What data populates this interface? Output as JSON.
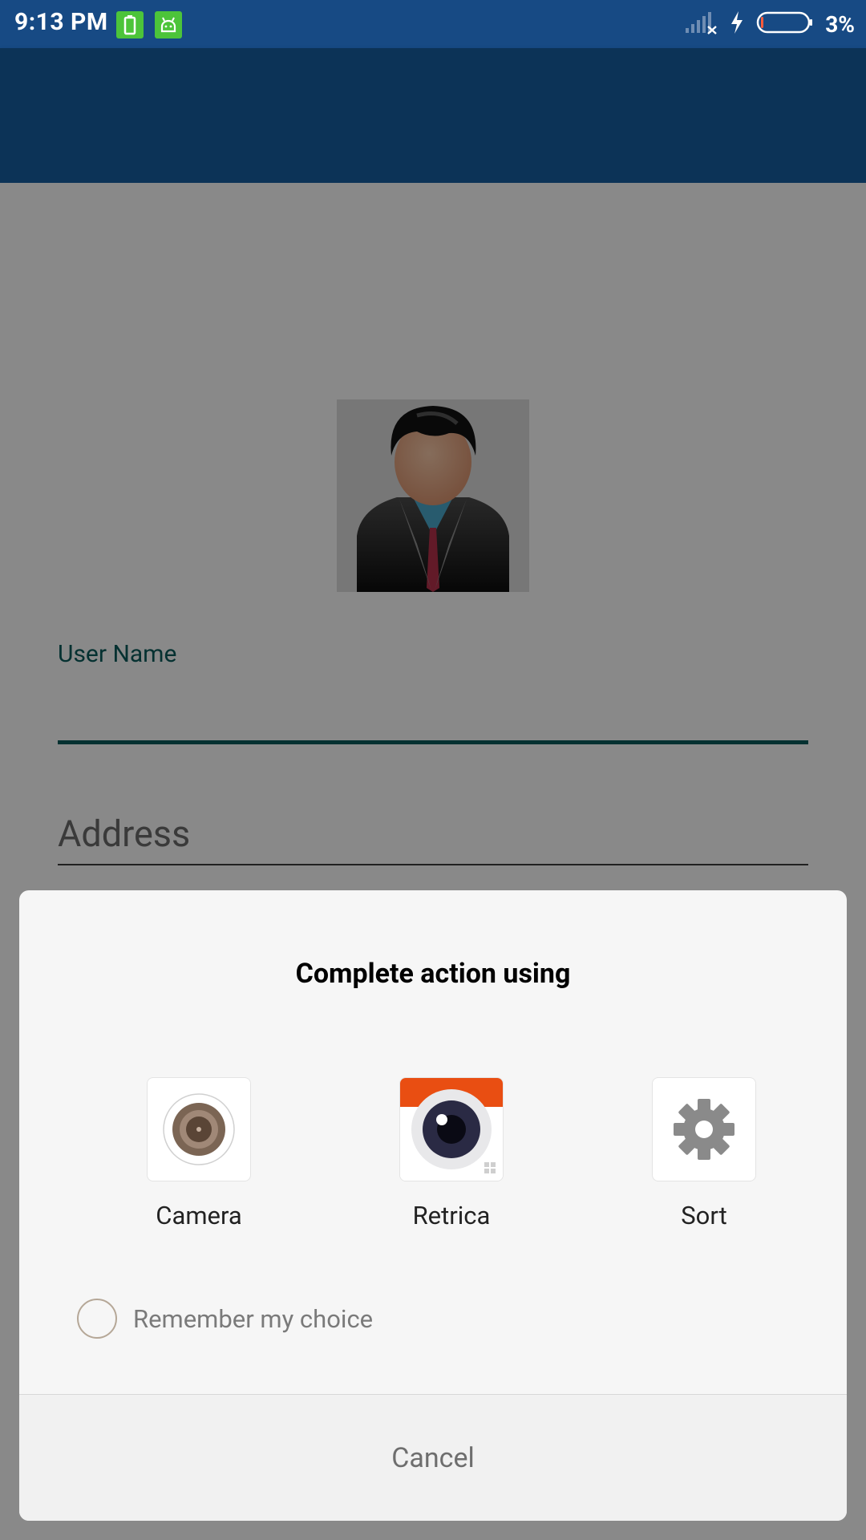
{
  "status_bar": {
    "time": "9:13 PM",
    "battery_percent": "3%",
    "icons": [
      "battery-saver-icon",
      "android-debug-icon",
      "signal-off-icon",
      "charging-bolt-icon",
      "battery-icon"
    ]
  },
  "form": {
    "username_label": "User Name",
    "address_placeholder": "Address",
    "avatar_icon": "person-avatar-icon"
  },
  "dialog": {
    "title": "Complete action using",
    "apps": [
      {
        "label": "Camera",
        "icon": "camera-lens-icon"
      },
      {
        "label": "Retrica",
        "icon": "retrica-eye-icon"
      },
      {
        "label": "Sort",
        "icon": "gear-icon"
      }
    ],
    "remember_label": "Remember my choice",
    "remember_checked": false,
    "cancel_label": "Cancel"
  },
  "colors": {
    "status_bar": "#174a84",
    "app_bar": "#165e9e",
    "accent": "#0a5a5a",
    "retrica_orange": "#e94e12"
  }
}
